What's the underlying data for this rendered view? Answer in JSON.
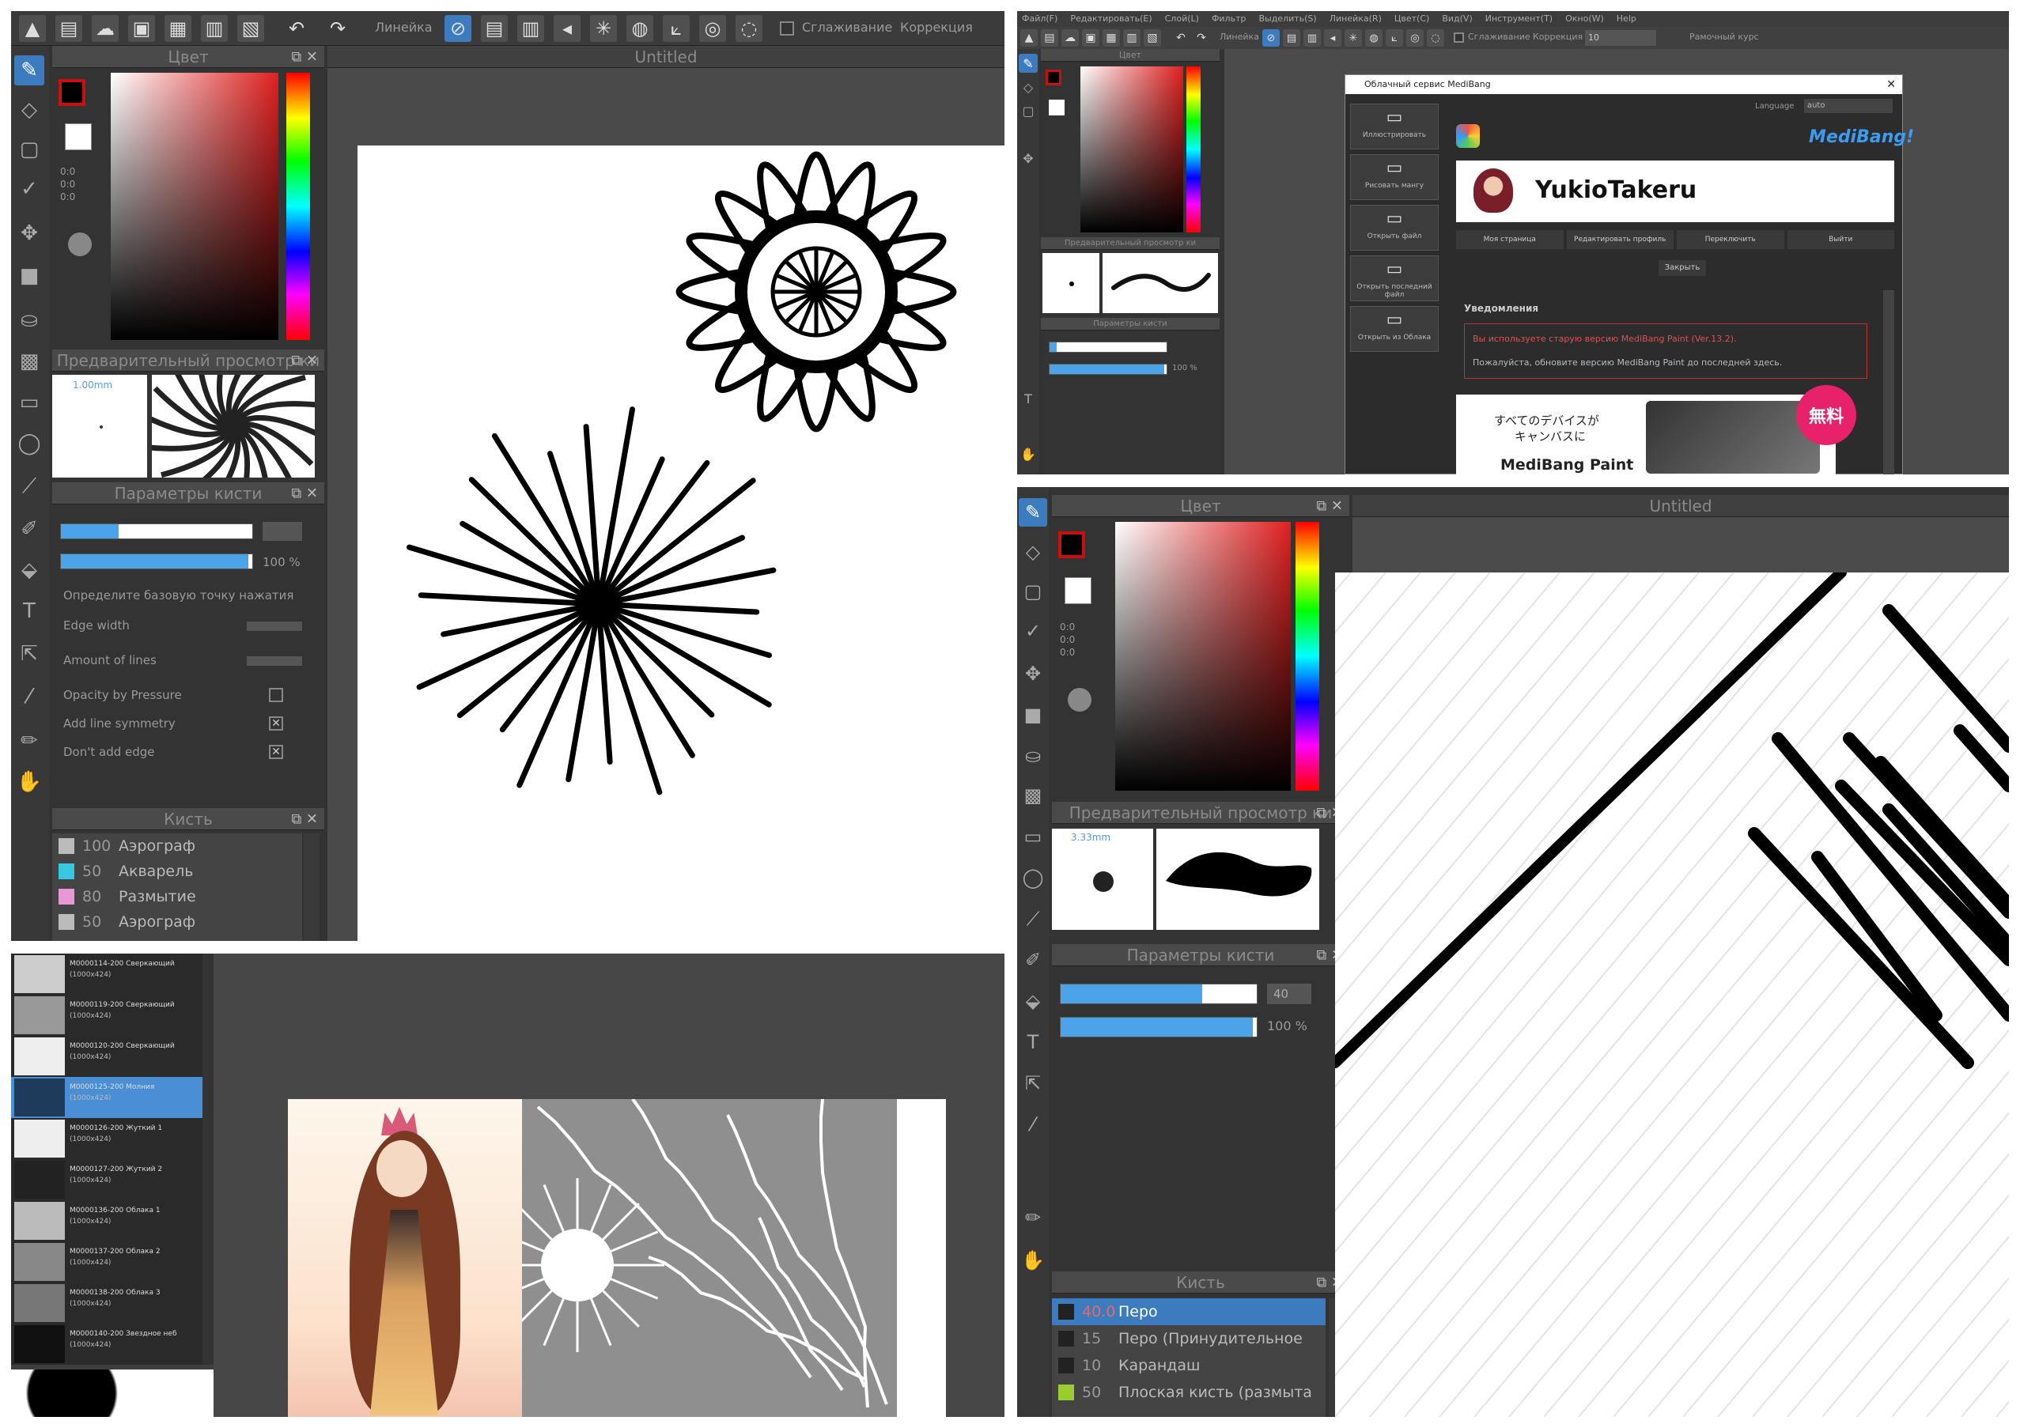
{
  "panel_a": {
    "toolbar": {
      "ruler_label": "Линейка",
      "smoothing_label": "Сглаживание",
      "correction_label": "Коррекция"
    },
    "canvas_title": "Untitled",
    "color_header": "Цвет",
    "color_values": [
      "0:0",
      "0:0",
      "0:0"
    ],
    "preview_header": "Предварительный просмотр ки",
    "brush_size_label": "1.00mm",
    "params_header": "Параметры кисти",
    "opacity_value": "100 %",
    "opacity_fraction": 0.98,
    "size_fraction": 0.3,
    "hint_text": "Определите базовую точку нажатия",
    "edge_width_label": "Edge width",
    "amount_lines_label": "Amount of lines",
    "opacity_pressure_label": "Opacity by Pressure",
    "add_line_symmetry_label": "Add line symmetry",
    "dont_add_edge_label": "Don't add edge",
    "brush_header": "Кисть",
    "brushes": [
      {
        "num": "100",
        "name": "Аэрограф",
        "color": "#bbbbbb"
      },
      {
        "num": "50",
        "name": "Акварель",
        "color": "#38c7e0"
      },
      {
        "num": "80",
        "name": "Размытие",
        "color": "#e59ad6"
      },
      {
        "num": "50",
        "name": "Аэрограф",
        "color": "#bbbbbb"
      }
    ]
  },
  "panel_b": {
    "menu": [
      "Файл(F)",
      "Редактировать(E)",
      "Слой(L)",
      "Фильтр",
      "Выделить(S)",
      "Линейка(R)",
      "Цвет(C)",
      "Вид(V)",
      "Инструмент(T)",
      "Окно(W)",
      "Help"
    ],
    "toolbar": {
      "ruler_label": "Линейка",
      "smoothing_label": "Сглаживание",
      "correction_label": "Коррекция",
      "smoothing_value": "10",
      "brush_cursor_label": "Рамочный курс"
    },
    "color_header": "Цвет",
    "preview_header": "Предварительный просмотр ки",
    "params_header": "Параметры кисти",
    "opacity_value": "100 %",
    "dialog": {
      "title": "Облачный сервис MediBang",
      "language_label": "Language",
      "language_value": "auto",
      "brand": "MediBang!",
      "username": "YukioTakeru",
      "nav": [
        "Моя страница",
        "Редактировать профиль",
        "Переключить",
        "Выйти"
      ],
      "close_label": "Закрыть",
      "notifications_header": "Уведомления",
      "warning": "Вы используете старую версию MediBang Paint (Ver.13.2).",
      "update_text": "Пожалуйста, обновите версию MediBang Paint до последней здесь.",
      "side_buttons": [
        "Иллюстрировать",
        "Рисовать мангу",
        "Открыть файл",
        "Открыть последний файл",
        "Открыть из Облака"
      ],
      "banner_line1": "すべてのデバイスが",
      "banner_line2": "キャンバスに",
      "banner_badge": "無料",
      "banner_app": "MediBang Paint"
    }
  },
  "panel_c": {
    "materials": [
      "M0000114-200 Сверкающий",
      "M0000119-200 Сверкающий",
      "M0000120-200 Сверкающий",
      "M0000125-200 Молния",
      "M0000126-200 Жуткий 1",
      "M0000127-200 Жуткий 2",
      "M0000136-200 Облака 1",
      "M0000137-200 Облака 2",
      "M0000138-200 Облака 3",
      "M0000140-200 Звездное неб"
    ],
    "material_size": "(1000x424)",
    "selected_index": 3
  },
  "panel_d": {
    "canvas_title": "Untitled",
    "color_header": "Цвет",
    "color_values": [
      "0:0",
      "0:0",
      "0:0"
    ],
    "preview_header": "Предварительный просмотр ки",
    "brush_size_label": "3.33mm",
    "params_header": "Параметры кисти",
    "size_value": "40",
    "opacity_value": "100 %",
    "size_fraction": 0.72,
    "opacity_fraction": 0.98,
    "brush_header": "Кисть",
    "brushes": [
      {
        "num": "40.0",
        "name": "Перо",
        "color": "#222222",
        "selected": true
      },
      {
        "num": "15",
        "name": "Перо (Принудительное",
        "color": "#222222",
        "selected": false
      },
      {
        "num": "10",
        "name": "Карандаш",
        "color": "#222222",
        "selected": false
      },
      {
        "num": "50",
        "name": "Плоская кисть (размыта",
        "color": "#9acd32",
        "selected": false
      }
    ]
  },
  "colors": {
    "accent": "#3d7bbf",
    "slider": "#4ba3e8",
    "bg_dark": "#2e2e2e",
    "panel_header": "#4a4a4a",
    "warning": "#e05050",
    "badge": "#e8226a"
  }
}
